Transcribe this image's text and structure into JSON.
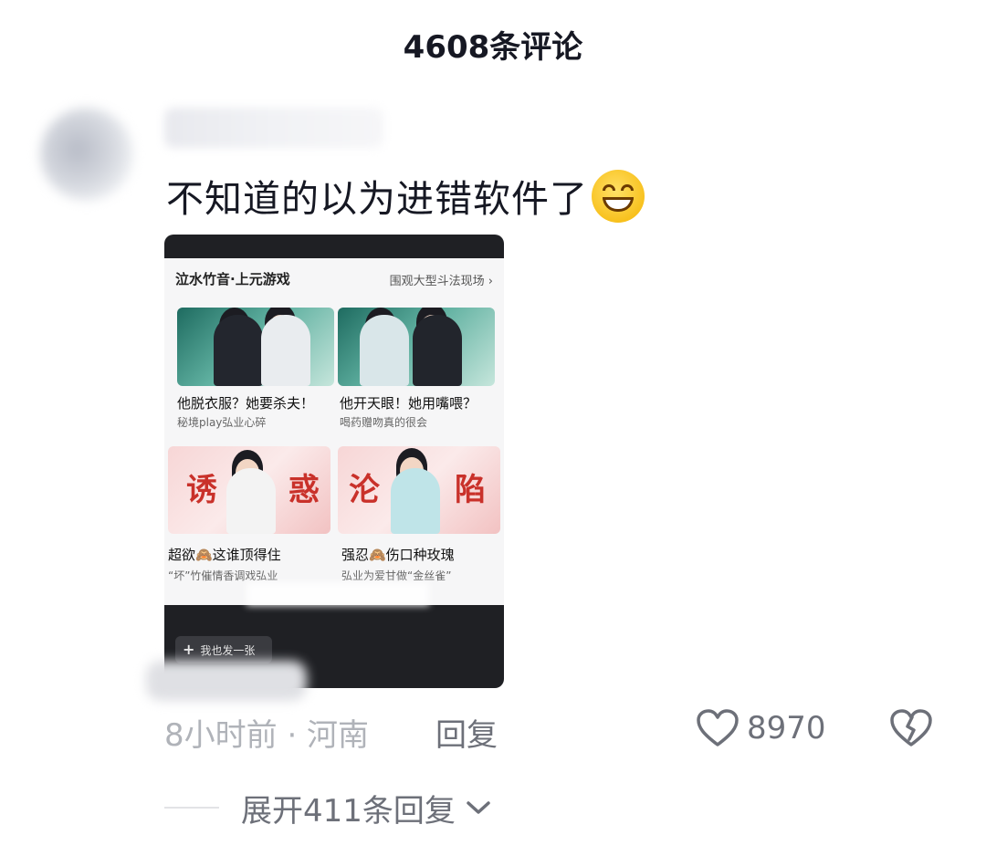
{
  "header": {
    "title": "4608条评论"
  },
  "comment": {
    "text": "不知道的以为进错软件了",
    "emoji_icon": "grinning-sweat-emoji",
    "image": {
      "section_title": "泣水竹音·上元游戏",
      "more_link": "围观大型斗法现场",
      "items": [
        {
          "title": "他脱衣服？她要杀夫！",
          "sub": "秘境play弘业心碎"
        },
        {
          "title": "他开天眼！她用嘴喂？",
          "sub": "喝药赠吻真的很会"
        },
        {
          "title": "超欲🙈这谁顶得住",
          "sub": "“坏”竹催情香调戏弘业",
          "char1": "诱",
          "char2": "惑"
        },
        {
          "title": "强忍🙈伤口种玫瑰",
          "sub": "弘业为爱甘做“金丝雀”",
          "char1": "沦",
          "char2": "陷"
        }
      ],
      "post_button": "我也发一张"
    },
    "meta": "8小时前 · 河南",
    "reply_label": "回复",
    "like_count": "8970"
  },
  "replies": {
    "expand_label": "展开411条回复"
  },
  "colors": {
    "text_primary": "#161823",
    "text_secondary": "#6d7079",
    "text_tertiary": "#b0b3b9"
  }
}
